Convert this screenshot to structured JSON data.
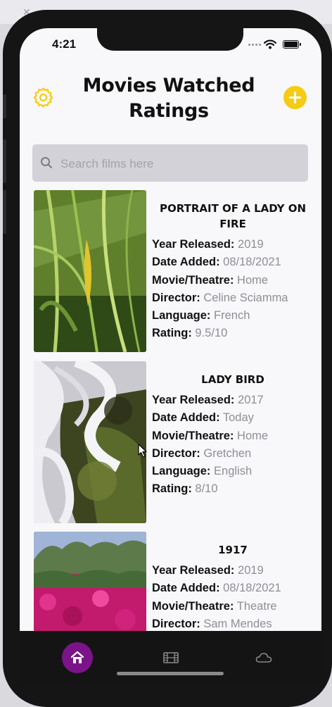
{
  "status_bar": {
    "time": "4:21"
  },
  "header": {
    "title": "Movies Watched Ratings",
    "settings_icon": "gear-icon",
    "add_icon": "plus-icon"
  },
  "search": {
    "placeholder": "Search films here",
    "value": ""
  },
  "labels": {
    "year": "Year Released:",
    "date_added": "Date Added:",
    "venue": "Movie/Theatre:",
    "director": "Director:",
    "language": "Language:",
    "rating": "Rating:"
  },
  "films": [
    {
      "title": "PORTRAIT OF A LADY ON FIRE",
      "year": "2019",
      "date_added": "08/18/2021",
      "venue": "Home",
      "director": "Celine Sciamma",
      "language": "French",
      "rating": "9.5/10"
    },
    {
      "title": "LADY BIRD",
      "year": "2017",
      "date_added": "Today",
      "venue": "Home",
      "director": "Gretchen",
      "language": "English",
      "rating": "8/10"
    },
    {
      "title": "1917",
      "year": "2019",
      "date_added": "08/18/2021",
      "venue": "Theatre",
      "director": "Sam Mendes",
      "language": "",
      "rating": ""
    }
  ],
  "tab_bar": {
    "tabs": [
      "home-icon",
      "film-icon",
      "cloud-icon"
    ],
    "active": "home-icon"
  },
  "colors": {
    "accent": "#f5cb14",
    "active_tab": "#7b1489",
    "value_text": "#8e8e95"
  }
}
